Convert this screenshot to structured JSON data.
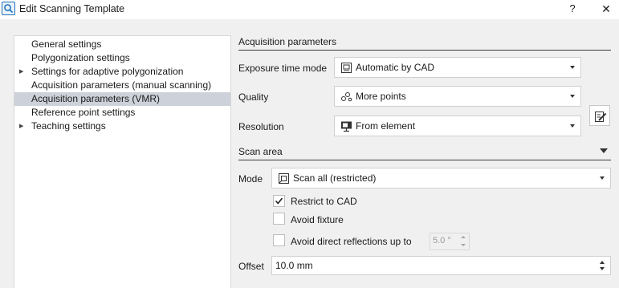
{
  "window": {
    "title": "Edit Scanning Template",
    "help_label": "?",
    "close_label": "✕"
  },
  "tree": {
    "items": [
      {
        "label": "General settings",
        "expandable": false,
        "selected": false
      },
      {
        "label": "Polygonization settings",
        "expandable": false,
        "selected": false
      },
      {
        "label": "Settings for adaptive polygonization",
        "expandable": true,
        "selected": false
      },
      {
        "label": "Acquisition parameters (manual scanning)",
        "expandable": false,
        "selected": false
      },
      {
        "label": "Acquisition parameters (VMR)",
        "expandable": false,
        "selected": true
      },
      {
        "label": "Reference point settings",
        "expandable": false,
        "selected": false
      },
      {
        "label": "Teaching settings",
        "expandable": true,
        "selected": false
      }
    ],
    "expander_glyph": "▶"
  },
  "acquisition": {
    "header": "Acquisition parameters",
    "exposure_label": "Exposure time mode",
    "exposure_value": "Automatic by CAD",
    "quality_label": "Quality",
    "quality_value": "More points",
    "resolution_label": "Resolution",
    "resolution_value": "From element"
  },
  "scan_area": {
    "header": "Scan area",
    "mode_label": "Mode",
    "mode_value": "Scan all (restricted)",
    "restrict_cad_label": "Restrict to CAD",
    "restrict_cad_checked": true,
    "avoid_fixture_label": "Avoid fixture",
    "avoid_fixture_checked": false,
    "avoid_reflections_label": "Avoid direct reflections up to",
    "avoid_reflections_checked": false,
    "reflection_angle": "5.0 °",
    "offset_label": "Offset",
    "offset_value": "10.0 mm"
  },
  "icons": {
    "app": "search-icon",
    "exposure": "cad-exposure-icon",
    "quality": "points-icon",
    "resolution": "resolution-monitor-icon",
    "mode": "scan-area-icon",
    "edit": "edit-icon",
    "check": "check-icon"
  },
  "colors": {
    "selection": "#cdd1d9",
    "dialog_background": "#f0f0f0",
    "accent": "#1e6fb8"
  }
}
